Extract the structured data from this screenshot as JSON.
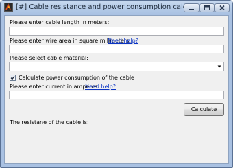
{
  "window": {
    "title": "[#] Cable resistance and power consumption calculator [#]",
    "app_icon": "app-icon",
    "controls": [
      "minimize-icon",
      "maximize-icon",
      "close-icon"
    ]
  },
  "form": {
    "cable_length_label": "Please enter cable length in meters:",
    "cable_length_value": "",
    "wire_area_label": "Please enter wire area in square milimeters:",
    "wire_area_help_link": "Need help?",
    "wire_area_value": "",
    "material_label": "Please select cable material:",
    "material_selected": "",
    "power_checkbox_label": "Calculate power consumption of the cable",
    "power_checkbox_checked": true,
    "current_label": "Please enter current in amperes:",
    "current_help_link": "Need help?",
    "current_value": "",
    "calculate_button": "Calculate",
    "result_label": "The resistane of the cable is:"
  }
}
